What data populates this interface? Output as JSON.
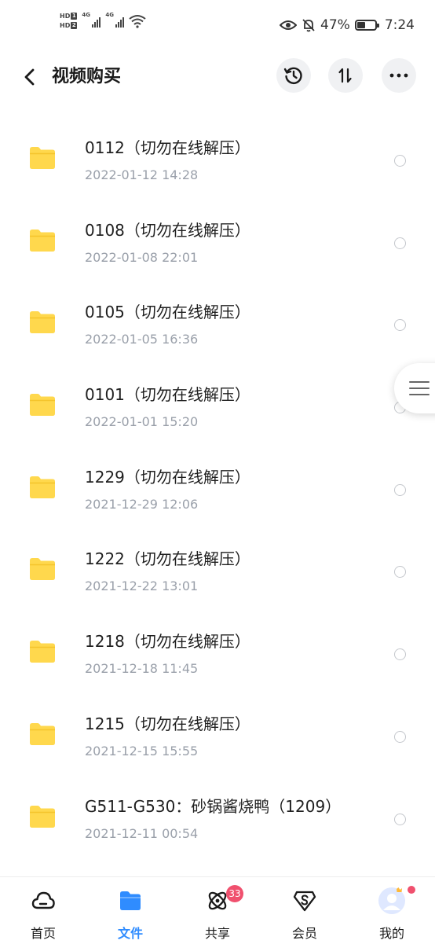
{
  "status_bar": {
    "hd1": "HD",
    "hd1_num": "1",
    "hd2": "HD",
    "hd2_num": "2",
    "network1": "4G",
    "network2": "4G",
    "battery_percent": "47%",
    "battery_level": 0.47,
    "time": "7:24",
    "icons": [
      "eye-icon",
      "bell-muted-icon",
      "wifi-icon",
      "battery-icon"
    ]
  },
  "header": {
    "title": "视频购买",
    "icons": [
      "back-arrow-icon",
      "history-icon",
      "sort-icon",
      "more-icon"
    ]
  },
  "files": [
    {
      "name": "0112（切勿在线解压）",
      "date": "2022-01-12  14:28"
    },
    {
      "name": "0108（切勿在线解压）",
      "date": "2022-01-08  22:01"
    },
    {
      "name": "0105（切勿在线解压）",
      "date": "2022-01-05  16:36"
    },
    {
      "name": "0101（切勿在线解压）",
      "date": "2022-01-01  15:20"
    },
    {
      "name": "1229（切勿在线解压）",
      "date": "2021-12-29  12:06"
    },
    {
      "name": "1222（切勿在线解压）",
      "date": "2021-12-22  13:01"
    },
    {
      "name": "1218（切勿在线解压）",
      "date": "2021-12-18  11:45"
    },
    {
      "name": "1215（切勿在线解压）",
      "date": "2021-12-15  15:55"
    },
    {
      "name": "G511-G530：砂锅酱烧鸭（1209）",
      "date": "2021-12-11  00:54"
    }
  ],
  "bottom_nav": {
    "items": [
      {
        "label": "首页",
        "icon": "cloud-home-icon",
        "active": false
      },
      {
        "label": "文件",
        "icon": "folder-icon",
        "active": true
      },
      {
        "label": "共享",
        "icon": "share-atom-icon",
        "active": false,
        "badge": "33"
      },
      {
        "label": "会员",
        "icon": "vip-diamond-icon",
        "active": false
      },
      {
        "label": "我的",
        "icon": "avatar-icon",
        "active": false,
        "dot": true
      }
    ]
  },
  "colors": {
    "accent": "#2f8cff",
    "folder": "#ffd84d",
    "badge": "#f0506e",
    "date_text": "#9aa0aa"
  }
}
